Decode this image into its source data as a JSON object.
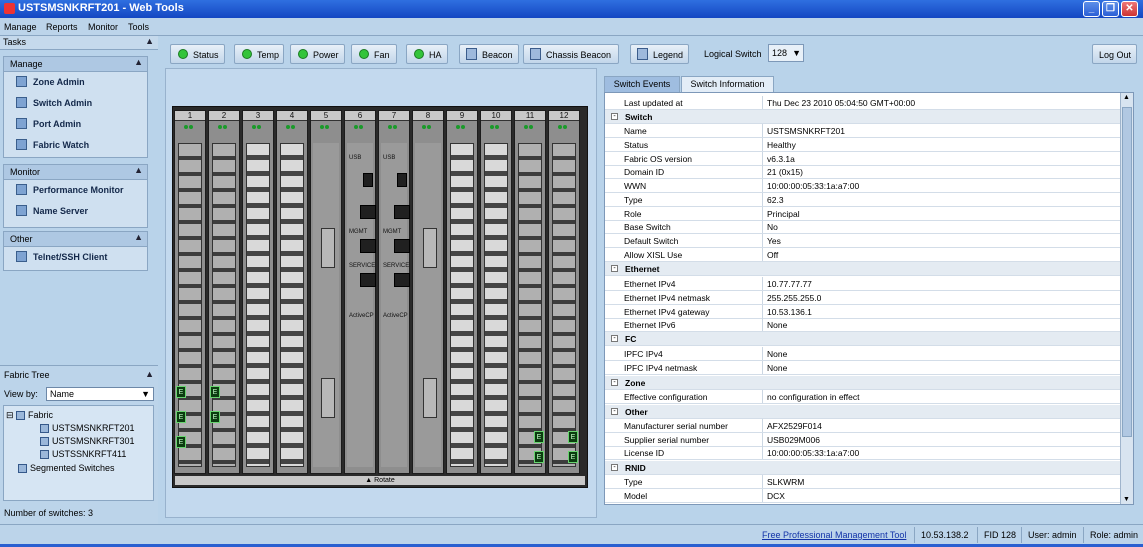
{
  "window": {
    "title": "USTSMSNKRFT201 - Web Tools"
  },
  "menu": [
    "Manage",
    "Reports",
    "Monitor",
    "Tools"
  ],
  "tasks": {
    "header": "Tasks",
    "groups": [
      {
        "title": "Manage",
        "items": [
          "Zone Admin",
          "Switch Admin",
          "Port Admin",
          "Fabric Watch"
        ]
      },
      {
        "title": "Monitor",
        "items": [
          "Performance Monitor",
          "Name Server"
        ]
      },
      {
        "title": "Other",
        "items": [
          "Telnet/SSH Client"
        ]
      }
    ]
  },
  "fabric_tree": {
    "header": "Fabric Tree",
    "view_by_label": "View by:",
    "view_by_value": "Name",
    "root": "Fabric",
    "switches": [
      "USTSMSNKRFT201",
      "USTSMSNKRFT301",
      "USTSSNKRFT411"
    ],
    "segmented": "Segmented Switches",
    "count_text": "Number of switches:  3"
  },
  "toolbar": {
    "status": "Status",
    "temp": "Temp",
    "power": "Power",
    "fan": "Fan",
    "ha": "HA",
    "beacon": "Beacon",
    "chassis_beacon": "Chassis Beacon",
    "legend": "Legend",
    "logical_switch_label": "Logical Switch",
    "logical_switch_value": "128",
    "logout": "Log Out"
  },
  "chassis": {
    "slots": [
      "1",
      "2",
      "3",
      "4",
      "5",
      "6",
      "7",
      "8",
      "9",
      "10",
      "11",
      "12"
    ],
    "bottom_label": "▲ Rotate",
    "cp_labels": {
      "usb": "USB",
      "mgmt": "MGMT",
      "service": "SERVICE",
      "active": "ActiveCP"
    }
  },
  "tabs": {
    "events": "Switch Events",
    "info": "Switch Information"
  },
  "info": {
    "last_updated_label": "Last updated at",
    "last_updated_value": "Thu Dec 23 2010 05:04:50 GMT+00:00",
    "sections": [
      {
        "title": "Switch",
        "rows": [
          [
            "Name",
            "USTSMSNKRFT201"
          ],
          [
            "Status",
            "Healthy"
          ],
          [
            "Fabric OS version",
            "v6.3.1a"
          ],
          [
            "Domain ID",
            "21 (0x15)"
          ],
          [
            "WWN",
            "10:00:00:05:33:1a:a7:00"
          ],
          [
            "Type",
            "62.3"
          ],
          [
            "Role",
            "Principal"
          ],
          [
            "Base Switch",
            "No"
          ],
          [
            "Default Switch",
            "Yes"
          ],
          [
            "Allow XISL Use",
            "Off"
          ]
        ]
      },
      {
        "title": "Ethernet",
        "rows": [
          [
            "Ethernet IPv4",
            "10.77.77.77"
          ],
          [
            "Ethernet IPv4 netmask",
            "255.255.255.0"
          ],
          [
            "Ethernet IPv4 gateway",
            "10.53.136.1"
          ],
          [
            "Ethernet IPv6",
            "None"
          ]
        ]
      },
      {
        "title": "FC",
        "rows": [
          [
            "IPFC IPv4",
            "None"
          ],
          [
            "IPFC IPv4 netmask",
            "None"
          ]
        ]
      },
      {
        "title": "Zone",
        "rows": [
          [
            "Effective configuration",
            "no configuration in effect"
          ]
        ]
      },
      {
        "title": "Other",
        "rows": [
          [
            "Manufacturer serial number",
            "AFX2529F014"
          ],
          [
            "Supplier serial number",
            "USB029M006"
          ],
          [
            "License ID",
            "10:00:00:05:33:1a:a7:00"
          ]
        ]
      },
      {
        "title": "RNID",
        "rows": [
          [
            "Type",
            "SLKWRM"
          ],
          [
            "Model",
            "DCX"
          ]
        ]
      }
    ]
  },
  "statusbar": {
    "link": "Free Professional Management Tool",
    "ip": "10.53.138.2",
    "fid": "FID 128",
    "user": "User: admin",
    "role": "Role: admin"
  }
}
